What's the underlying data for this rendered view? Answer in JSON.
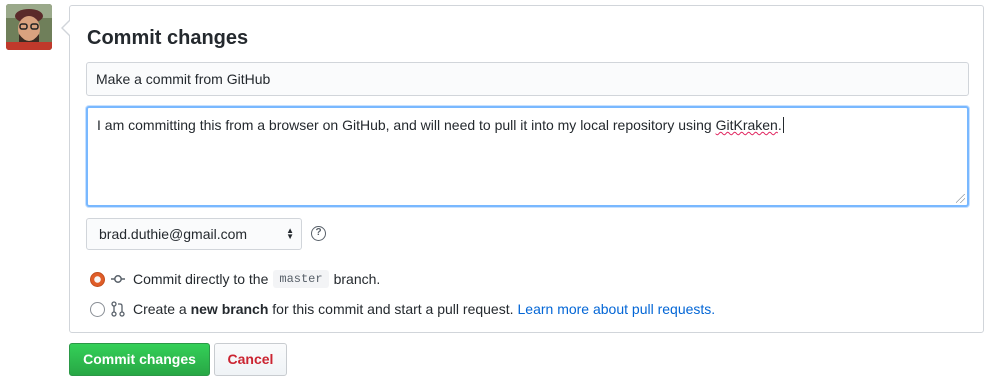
{
  "user": {
    "avatar_icon": "user-avatar-photo"
  },
  "form": {
    "title": "Commit changes",
    "summary_value": "Make a commit from GitHub",
    "description_value_before": "I am committing this from a browser on GitHub, and will need to pull it into my local repository using ",
    "description_value_misspelled": "GitKraken",
    "description_value_after": ".",
    "email_selected": "brad.duthie@gmail.com",
    "help_icon": "question-circle-icon"
  },
  "options": {
    "direct": {
      "checked": true,
      "label_before": "Commit directly to the",
      "branch_name": "master",
      "label_after": "branch.",
      "icon": "git-commit-icon"
    },
    "new_branch": {
      "checked": false,
      "label_before": "Create a",
      "label_bold": "new branch",
      "label_after": "for this commit and start a pull request.",
      "link_text": "Learn more about pull requests.",
      "icon": "git-pull-request-icon"
    }
  },
  "buttons": {
    "commit_label": "Commit changes",
    "cancel_label": "Cancel"
  },
  "colors": {
    "primary_button": "#28a745",
    "cancel_text": "#cb2431",
    "link": "#0366d6",
    "radio_checked": "#e05d28",
    "focus_border": "#79b8ff"
  }
}
